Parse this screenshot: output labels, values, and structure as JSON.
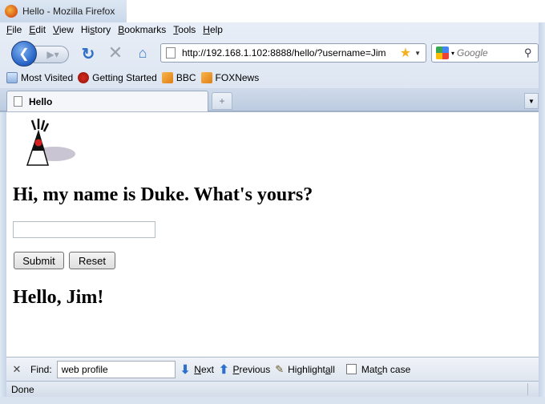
{
  "window": {
    "title": "Hello - Mozilla Firefox"
  },
  "menu": {
    "file": {
      "u": "F",
      "rest": "ile"
    },
    "edit": {
      "u": "E",
      "rest": "dit"
    },
    "view": {
      "u": "V",
      "rest": "iew"
    },
    "history_pre": "Hi",
    "history_u": "s",
    "history_rest": "tory",
    "bookmarks": {
      "u": "B",
      "rest": "ookmarks"
    },
    "tools": {
      "u": "T",
      "rest": "ools"
    },
    "help": {
      "u": "H",
      "rest": "elp"
    }
  },
  "navbar": {
    "url": "http://192.168.1.102:8888/hello/?username=Jim",
    "search_placeholder": "Google"
  },
  "bookmarks": [
    {
      "label": "Most Visited",
      "icon": "most-visited-icon"
    },
    {
      "label": "Getting Started",
      "icon": "getting-started-icon"
    },
    {
      "label": "BBC",
      "icon": "rss-feed-icon"
    },
    {
      "label": "FOXNews",
      "icon": "rss-feed-icon"
    }
  ],
  "tab": {
    "label": "Hello"
  },
  "page": {
    "heading": "Hi, my name is Duke. What's yours?",
    "input_value": "",
    "submit_label": "Submit",
    "reset_label": "Reset",
    "greeting": "Hello, Jim!"
  },
  "findbar": {
    "label": "Find:",
    "query": "web profile",
    "next_u": "N",
    "next_rest": "ext",
    "prev_u": "P",
    "prev_rest": "revious",
    "highlight_pre": "Highlight ",
    "highlight_u": "a",
    "highlight_rest": "ll",
    "match_pre": "Mat",
    "match_u": "c",
    "match_rest": "h case"
  },
  "status": {
    "text": "Done"
  }
}
